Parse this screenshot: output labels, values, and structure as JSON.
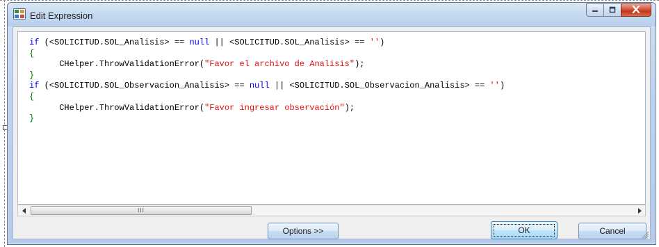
{
  "window": {
    "title": "Edit Expression",
    "icon": "expression-editor-icon",
    "caption_buttons": {
      "minimize": "minimize-icon",
      "maximize": "maximize-icon",
      "close": "close-icon"
    }
  },
  "editor": {
    "lines": [
      [
        {
          "t": "if",
          "c": "kw"
        },
        {
          "t": " (<SOLICITUD.SOL_Analisis> == ",
          "c": ""
        },
        {
          "t": "null",
          "c": "kw"
        },
        {
          "t": " || <SOLICITUD.SOL_Analisis> == ",
          "c": ""
        },
        {
          "t": "''",
          "c": "str"
        },
        {
          "t": ")",
          "c": ""
        }
      ],
      [
        {
          "t": "{",
          "c": "brace"
        }
      ],
      [
        {
          "t": "      CHelper.ThrowValidationError(",
          "c": ""
        },
        {
          "t": "\"Favor el archivo de Analisis\"",
          "c": "str"
        },
        {
          "t": ");",
          "c": ""
        }
      ],
      [
        {
          "t": "}",
          "c": "brace"
        }
      ],
      [
        {
          "t": "if",
          "c": "kw"
        },
        {
          "t": " (<SOLICITUD.SOL_Observacion_Analisis> == ",
          "c": ""
        },
        {
          "t": "null",
          "c": "kw"
        },
        {
          "t": " || <SOLICITUD.SOL_Observacion_Analisis> == ",
          "c": ""
        },
        {
          "t": "''",
          "c": "str"
        },
        {
          "t": ")",
          "c": ""
        }
      ],
      [
        {
          "t": "{",
          "c": "brace"
        }
      ],
      [
        {
          "t": "      CHelper.ThrowValidationError(",
          "c": ""
        },
        {
          "t": "\"Favor ingresar observación\"",
          "c": "str"
        },
        {
          "t": ");",
          "c": ""
        }
      ],
      [
        {
          "t": "}",
          "c": "brace"
        }
      ]
    ],
    "colors": {
      "keyword": "#0000ff",
      "string": "#e01010",
      "brace": "#008000",
      "text": "#000000"
    }
  },
  "scrollbar": {
    "thumb_grip": "III",
    "left_arrow": "scroll-left-arrow-icon",
    "right_arrow": "scroll-right-arrow-icon"
  },
  "buttons": {
    "options_label": "Options >>",
    "ok_label": "OK",
    "cancel_label": "Cancel"
  }
}
